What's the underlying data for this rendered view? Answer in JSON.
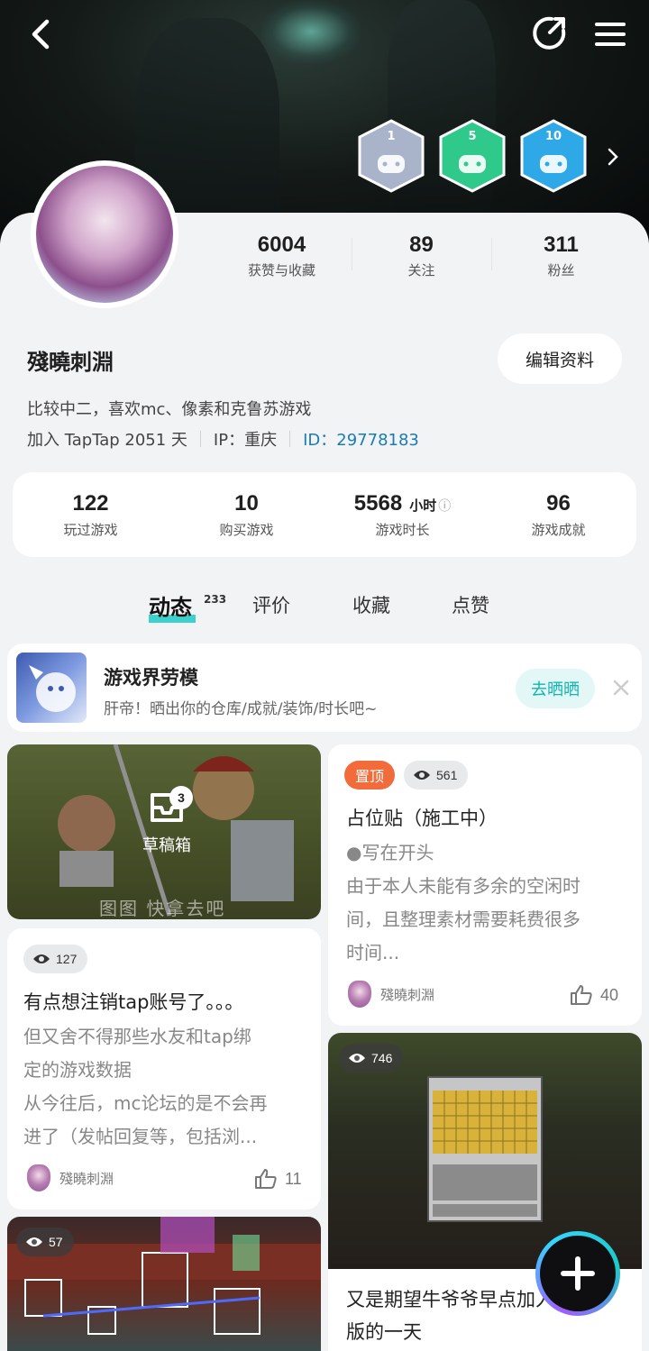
{
  "profile": {
    "name": "殘曉刺淵",
    "edit_label": "编辑资料",
    "bio": "比较中二，喜欢mc、像素和克鲁苏游戏",
    "join": "加入 TapTap 2051 天",
    "ip": "IP：重庆",
    "id": "ID：29778183",
    "stats": [
      {
        "value": "6004",
        "label": "获赞与收藏"
      },
      {
        "value": "89",
        "label": "关注"
      },
      {
        "value": "311",
        "label": "粉丝"
      }
    ],
    "badges": [
      {
        "num": "1",
        "color": "#a9b3c9"
      },
      {
        "num": "5",
        "color": "#2fc98b"
      },
      {
        "num": "10",
        "color": "#2fa8e8"
      }
    ]
  },
  "game_stats": [
    {
      "value": "122",
      "label": "玩过游戏"
    },
    {
      "value": "10",
      "label": "购买游戏"
    },
    {
      "value": "5568",
      "unit": "小时",
      "label": "游戏时长"
    },
    {
      "value": "96",
      "label": "游戏成就"
    }
  ],
  "tabs": {
    "items": [
      "动态",
      "评价",
      "收藏",
      "点赞"
    ],
    "active_count": "233"
  },
  "promo": {
    "title": "游戏界劳模",
    "subtitle": "肝帝！晒出你的仓库/成就/装饰/时长吧~",
    "action": "去晒晒"
  },
  "draft": {
    "label": "草稿箱",
    "count": "3",
    "caption": "图图 快拿去吧"
  },
  "posts": [
    {
      "pin_label": "置顶",
      "views": "561",
      "title": "占位贴（施工中）",
      "body": [
        "●写在开头",
        "由于本人未能有多余的空闲时",
        "间，且整理素材需要耗费很多",
        "时间..."
      ],
      "author": "殘曉刺淵",
      "likes": "40"
    },
    {
      "views": "127",
      "title": "有点想注销tap账号了。。。",
      "body": [
        "但又舍不得那些水友和tap绑",
        "定的游戏数据",
        "从今往后，mc论坛的是不会再",
        "进了（发帖回复等，包括浏..."
      ],
      "author": "殘曉刺淵",
      "likes": "11"
    },
    {
      "views": "746",
      "title_lines": [
        "又是期望牛爷爷早点加入正式",
        "版的一天"
      ]
    },
    {
      "views": "57"
    }
  ],
  "colors": {
    "accent": "#1ccac8",
    "link": "#1a7bb5",
    "pin": "#f26b3a"
  }
}
